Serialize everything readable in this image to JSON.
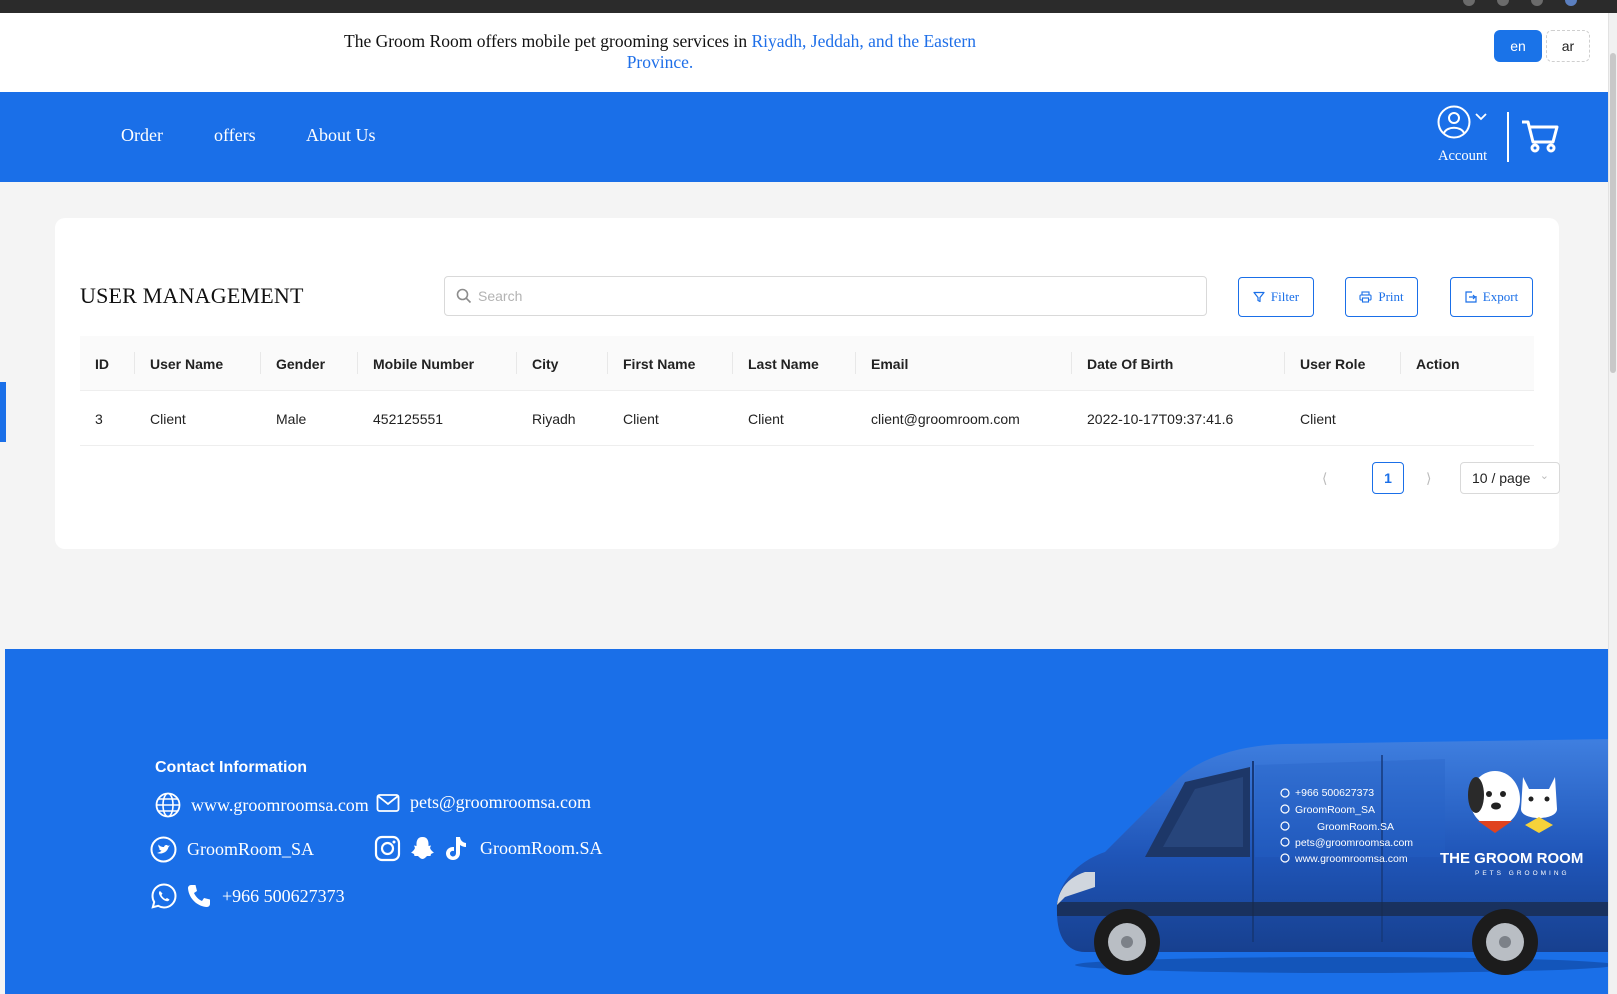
{
  "announcement": {
    "prefix": "The Groom Room offers mobile pet grooming services in ",
    "highlight": "Riyadh, Jeddah, and the Eastern Province."
  },
  "languages": {
    "en": "en",
    "ar": "ar"
  },
  "nav": {
    "order": "Order",
    "offers": "offers",
    "about": "About Us",
    "account": "Account"
  },
  "page": {
    "title": "USER MANAGEMENT",
    "search_placeholder": "Search",
    "filter_label": "Filter",
    "print_label": "Print",
    "export_label": "Export"
  },
  "table": {
    "columns": [
      "ID",
      "User Name",
      "Gender",
      "Mobile Number",
      "City",
      "First Name",
      "Last Name",
      "Email",
      "Date Of Birth",
      "User Role",
      "Action"
    ],
    "rows": [
      [
        "3",
        "Client",
        "Male",
        "452125551",
        "Riyadh",
        "Client",
        "Client",
        "client@groomroom.com",
        "2022-10-17T09:37:41.6",
        "Client",
        ""
      ]
    ]
  },
  "pagination": {
    "current": "1",
    "page_size": "10 / page"
  },
  "footer": {
    "title": "Contact Information",
    "website": "www.groomroomsa.com",
    "email": "pets@groomroomsa.com",
    "twitter": "GroomRoom_SA",
    "social": "GroomRoom.SA",
    "phone": "+966 500627373"
  },
  "van": {
    "phone": "+966 500627373",
    "twitter": "GroomRoom_SA",
    "social": "GroomRoom.SA",
    "email": "pets@groomroomsa.com",
    "website": "www.groomroomsa.com",
    "brand": "THE GROOM ROOM",
    "tagline": "PETS GROOMING"
  },
  "colors": {
    "brand_blue": "#1a6fe8",
    "link_blue": "#1f6fe8"
  }
}
